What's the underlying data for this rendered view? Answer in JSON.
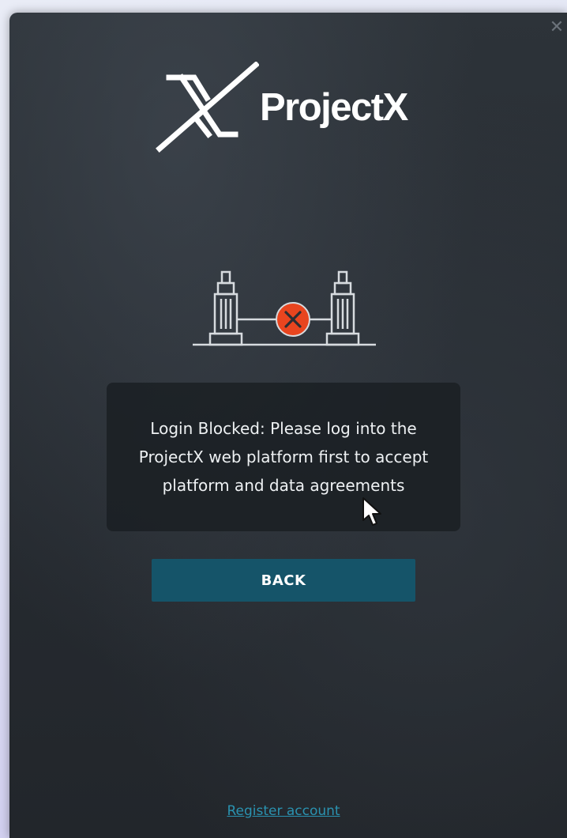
{
  "window": {
    "close_glyph": "✕"
  },
  "logo": {
    "text": "ProjectX",
    "icon": "projectx-logo-icon"
  },
  "illustration": {
    "icon": "connection-blocked-icon",
    "accent_color": "#e8451f"
  },
  "message": {
    "text": "Login Blocked: Please log into the ProjectX web platform first to accept platform and data agreements"
  },
  "back_button": {
    "label": "BACK",
    "color": "#155469"
  },
  "register_link": {
    "label": "Register account",
    "color": "#2a92b0"
  },
  "pointer": {
    "icon": "mouse-cursor-icon"
  }
}
